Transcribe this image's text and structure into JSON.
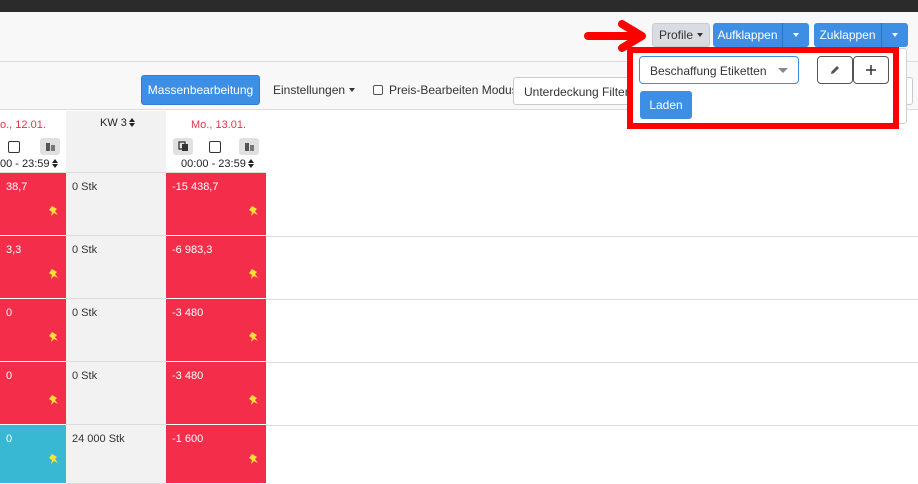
{
  "header": {
    "profile_label": "Profile",
    "aufklappen_label": "Aufklappen",
    "zuklappen_label": "Zuklappen"
  },
  "toolbar": {
    "mass_edit_label": "Massenbearbeitung",
    "settings_label": "Einstellungen",
    "price_edit_label": "Preis-Bearbeiten Modus",
    "filter_text": "Unterdeckung Filter g"
  },
  "grid": {
    "col1": {
      "date": "o., 12.01.",
      "time": "00 - 23:59"
    },
    "col2": {
      "week": "KW 3"
    },
    "col3": {
      "date": "Mo., 13.01.",
      "time": "00:00 - 23:59"
    },
    "rows": [
      {
        "a": "38,7",
        "b": "0 Stk",
        "c": "-15 438,7"
      },
      {
        "a": "3,3",
        "b": "0 Stk",
        "c": "-6 983,3"
      },
      {
        "a": "0",
        "b": "0 Stk",
        "c": "-3 480"
      },
      {
        "a": "0",
        "b": "0 Stk",
        "c": "-3 480"
      },
      {
        "a": "0",
        "b": "24 000 Stk",
        "c": "-1 600"
      }
    ]
  },
  "popup": {
    "selected_profile": "Beschaffung Etiketten",
    "load_label": "Laden"
  },
  "colors": {
    "accent": "#3d8fe6",
    "negative": "#f32d4a",
    "positive": "#38b8d2",
    "annotation": "#ff0000"
  }
}
